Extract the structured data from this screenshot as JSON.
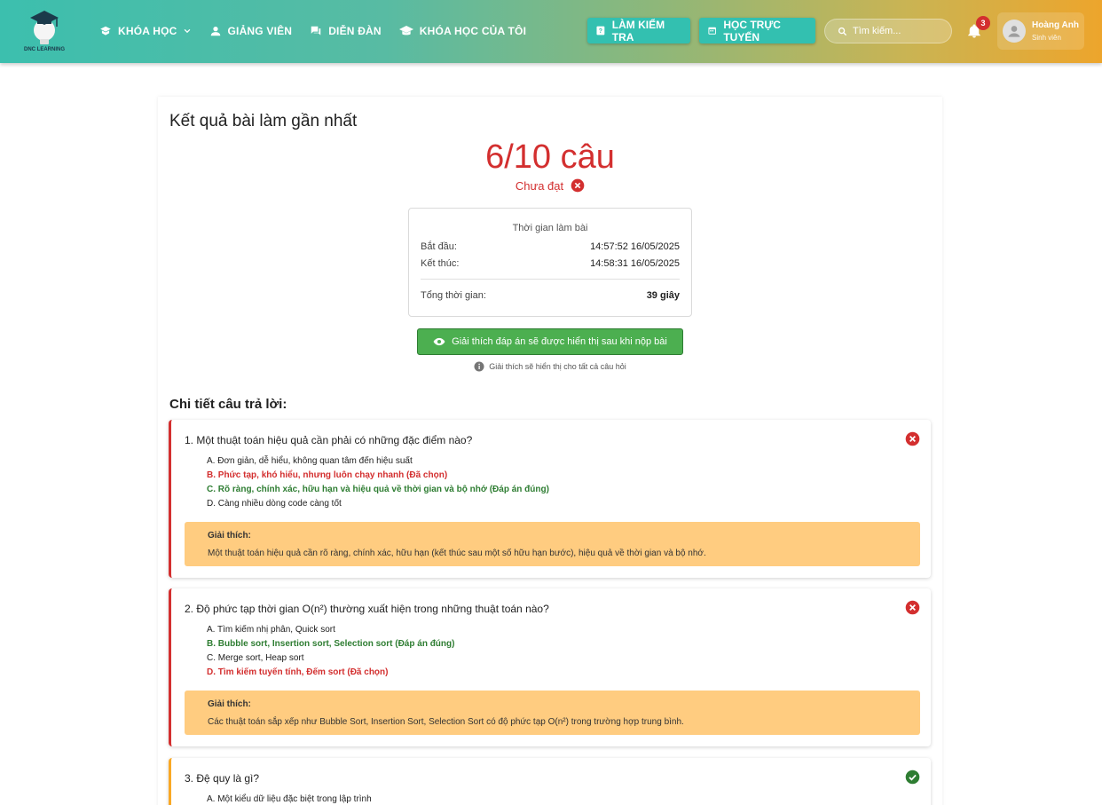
{
  "brand": {
    "name": "DNC LEARNING"
  },
  "nav": [
    {
      "label": "KHÓA HỌC"
    },
    {
      "label": "GIẢNG VIÊN"
    },
    {
      "label": "DIỄN ĐÀN"
    },
    {
      "label": "KHÓA HỌC CỦA TÔI"
    }
  ],
  "actions": {
    "test_label": "LÀM KIỂM TRA",
    "online_label": "HỌC TRỰC TUYẾN"
  },
  "search": {
    "placeholder": "Tìm kiếm..."
  },
  "notifications": {
    "count": "3"
  },
  "user": {
    "name": "Hoàng Anh",
    "role": "Sinh viên"
  },
  "result": {
    "title": "Kết quả bài làm gần nhất",
    "score": "6/10 câu",
    "status": "Chưa đạt"
  },
  "time": {
    "title": "Thời gian làm bài",
    "start_label": "Bắt đầu:",
    "start_value": "14:57:52 16/05/2025",
    "end_label": "Kết thúc:",
    "end_value": "14:58:31 16/05/2025",
    "total_label": "Tổng thời gian:",
    "total_value": "39 giây"
  },
  "explain_button": "Giải thích đáp án sẽ được hiển thị sau khi nộp bài",
  "explain_note": "Giải thích sẽ hiển thị cho tất cả câu hỏi",
  "detail_title": "Chi tiết câu trả lời:",
  "questions": [
    {
      "title": "1. Một thuật toán hiệu quả cần phải có những đặc điểm nào?",
      "options": [
        "A. Đơn giản, dễ hiểu, không quan tâm đến hiệu suất",
        "B. Phức tạp, khó hiểu, nhưng luôn chạy nhanh (Đã chọn)",
        "C. Rõ ràng, chính xác, hữu hạn và hiệu quả về thời gian và bộ nhớ (Đáp án đúng)",
        "D. Càng nhiều dòng code càng tốt"
      ],
      "explanation_label": "Giải thích:",
      "explanation": "Một thuật toán hiệu quả cần rõ ràng, chính xác, hữu hạn (kết thúc sau một số hữu hạn bước), hiệu quả về thời gian và bộ nhớ."
    },
    {
      "title": "2. Độ phức tạp thời gian O(n²) thường xuất hiện trong những thuật toán nào?",
      "options": [
        "A. Tìm kiếm nhị phân, Quick sort",
        "B. Bubble sort, Insertion sort, Selection sort (Đáp án đúng)",
        "C. Merge sort, Heap sort",
        "D. Tìm kiếm tuyến tính, Đếm sort (Đã chọn)"
      ],
      "explanation_label": "Giải thích:",
      "explanation": "Các thuật toán sắp xếp như Bubble Sort, Insertion Sort, Selection Sort có độ phức tạp O(n²) trong trường hợp trung bình."
    },
    {
      "title": "3. Đệ quy là gì?",
      "options": [
        "A. Một kiểu dữ liệu đặc biệt trong lập trình"
      ]
    }
  ],
  "colors": {
    "wrong": "#d32f2f",
    "correct": "#2e7d32",
    "explanation_bg": "#ffcc80",
    "accent": "#33c0b0"
  }
}
